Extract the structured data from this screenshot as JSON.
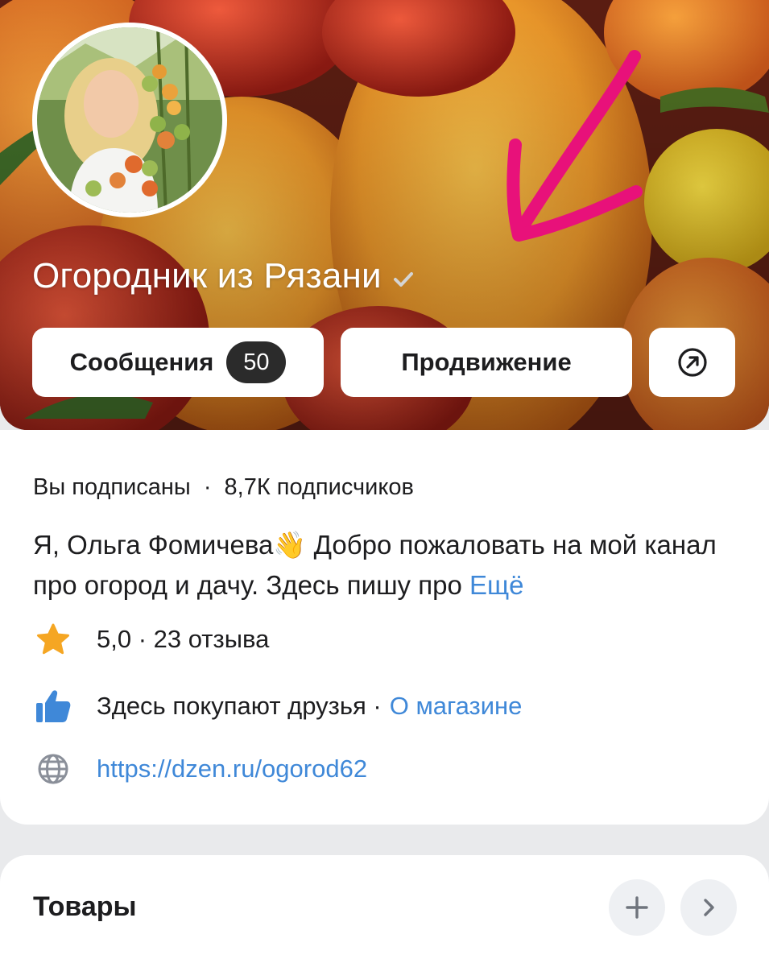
{
  "channel": {
    "title": "Огородник из Рязани",
    "verified_icon": "check-icon"
  },
  "buttons": {
    "messages_label": "Сообщения",
    "messages_count": "50",
    "promo_label": "Продвижение",
    "share_icon": "arrow-up-right-circle-icon"
  },
  "info": {
    "subscribed": "Вы подписаны",
    "separator": "·",
    "subscribers": "8,7К подписчиков",
    "description": "Я, Ольга Фомичева👋 Добро пожаловать на мой канал про огород и дачу. Здесь пишу про",
    "more_link": "Ещё",
    "rating": "5,0 · 23 отзыва",
    "shop_text": "Здесь покупают друзья ·",
    "shop_link": "О магазине",
    "url": "https://dzen.ru/ogorod62"
  },
  "goods": {
    "title": "Товары",
    "add_icon": "plus-icon",
    "next_icon": "chevron-right-icon"
  },
  "colors": {
    "accent_link": "#3f88d8",
    "arrow_annotation": "#e8117a",
    "star": "#f5a623",
    "thumb": "#3f88d8"
  }
}
